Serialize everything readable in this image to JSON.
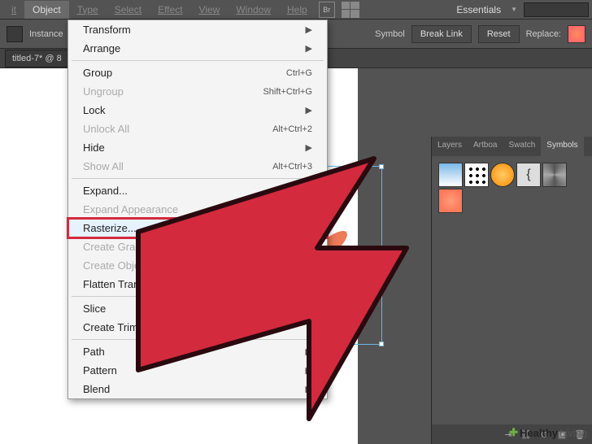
{
  "menubar": {
    "items": [
      "it",
      "Object",
      "Type",
      "Select",
      "Effect",
      "View",
      "Window",
      "Help"
    ],
    "workspace": "Essentials"
  },
  "optbar": {
    "instance": "Instance",
    "symbol": "Symbol",
    "break": "Break Link",
    "reset": "Reset",
    "replace": "Replace:"
  },
  "tab": {
    "name": "titled-7* @ 8"
  },
  "dropdown": {
    "transform": "Transform",
    "arrange": "Arrange",
    "group": {
      "label": "Group",
      "sc": "Ctrl+G"
    },
    "ungroup": {
      "label": "Ungroup",
      "sc": "Shift+Ctrl+G"
    },
    "lock": "Lock",
    "unlockall": {
      "label": "Unlock All",
      "sc": "Alt+Ctrl+2"
    },
    "hide": "Hide",
    "showall": {
      "label": "Show All",
      "sc": "Alt+Ctrl+3"
    },
    "expand": "Expand...",
    "expandapp": "Expand Appearance",
    "rasterize": "Rasterize...",
    "gradientmesh": "Create Gradie",
    "objectmosaic": "Create Object M",
    "flatten": "Flatten Transparency",
    "slice": "Slice",
    "trimmarks": "Create Trim Marks",
    "path": "Path",
    "pattern": "Pattern",
    "blend": "Blend"
  },
  "panels": {
    "tabs": [
      "Layers",
      "Artboa",
      "Swatch",
      "Symbols"
    ]
  },
  "watermark": {
    "brand1": "Healthy",
    "brand2": "Living"
  }
}
